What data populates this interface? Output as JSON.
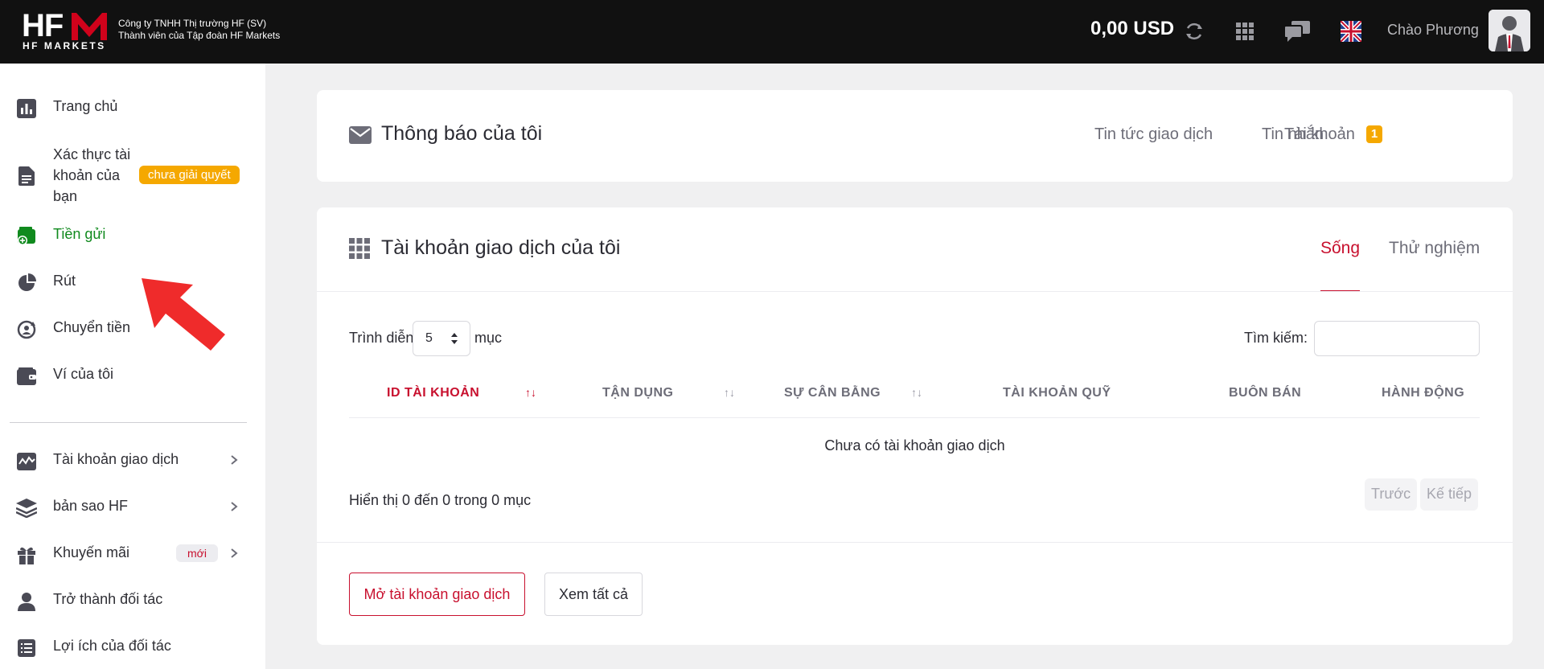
{
  "header": {
    "logo_text": "HF",
    "logo_sub": "HF MARKETS",
    "company_line1": "Công ty TNHH Thị trường HF (SV)",
    "company_line2": "Thành viên của Tập đoàn HF Markets",
    "balance": "0,00 USD",
    "greeting": "Chào Phương",
    "icons": [
      "refresh-icon",
      "apps-grid-icon",
      "chat-icon",
      "uk-flag-icon",
      "avatar"
    ]
  },
  "sidebar": {
    "items": [
      {
        "label": "Trang chủ",
        "icon": "bar-chart-icon"
      },
      {
        "label": "Xác thực tài khoản của bạn",
        "icon": "document-icon",
        "badge": "chưa giải quyết"
      },
      {
        "label": "Tiền gửi",
        "icon": "deposit-wallet-icon",
        "active": true
      },
      {
        "label": "Rút",
        "icon": "withdraw-icon"
      },
      {
        "label": "Chuyển tiền",
        "icon": "transfer-icon"
      },
      {
        "label": "Ví của tôi",
        "icon": "wallet-icon"
      },
      {
        "label": "Tài khoản giao dịch",
        "icon": "trading-chart-icon"
      },
      {
        "label": "bản sao HF",
        "icon": "layers-icon"
      },
      {
        "label": "Khuyến mãi",
        "icon": "gift-icon",
        "badge": "mới"
      },
      {
        "label": "Trở thành đối tác",
        "icon": "user-icon"
      },
      {
        "label": "Lợi ích của đối tác",
        "icon": "list-icon"
      }
    ]
  },
  "notifications": {
    "title": "Thông báo của tôi",
    "tabs": [
      "Tin tức giao dịch",
      "Tin nhắn",
      "Tài khoản"
    ],
    "account_count": "1"
  },
  "accounts": {
    "title": "Tài khoản giao dịch của tôi",
    "tab_live": "Sống",
    "tab_demo": "Thử nghiệm",
    "show_label": "Trình diễn",
    "show_value": "5",
    "entries_label": "mục",
    "search_label": "Tìm kiếm:",
    "columns": [
      "ID TÀI KHOẢN",
      "TẬN DỤNG",
      "SỰ CÂN BẰNG",
      "TÀI KHOẢN QUỸ",
      "BUÔN BÁN",
      "HÀNH ĐỘNG"
    ],
    "empty_message": "Chưa có tài khoản giao dịch",
    "info": "Hiển thị 0 đến 0 trong 0 mục",
    "prev": "Trước",
    "next": "Kế tiếp",
    "open_button": "Mở tài khoản giao dịch",
    "view_all_button": "Xem tất cả"
  },
  "colors": {
    "accent": "#c8102e",
    "active_green": "#108a1e",
    "badge_orange": "#f5a800",
    "header_bg": "#111111"
  }
}
